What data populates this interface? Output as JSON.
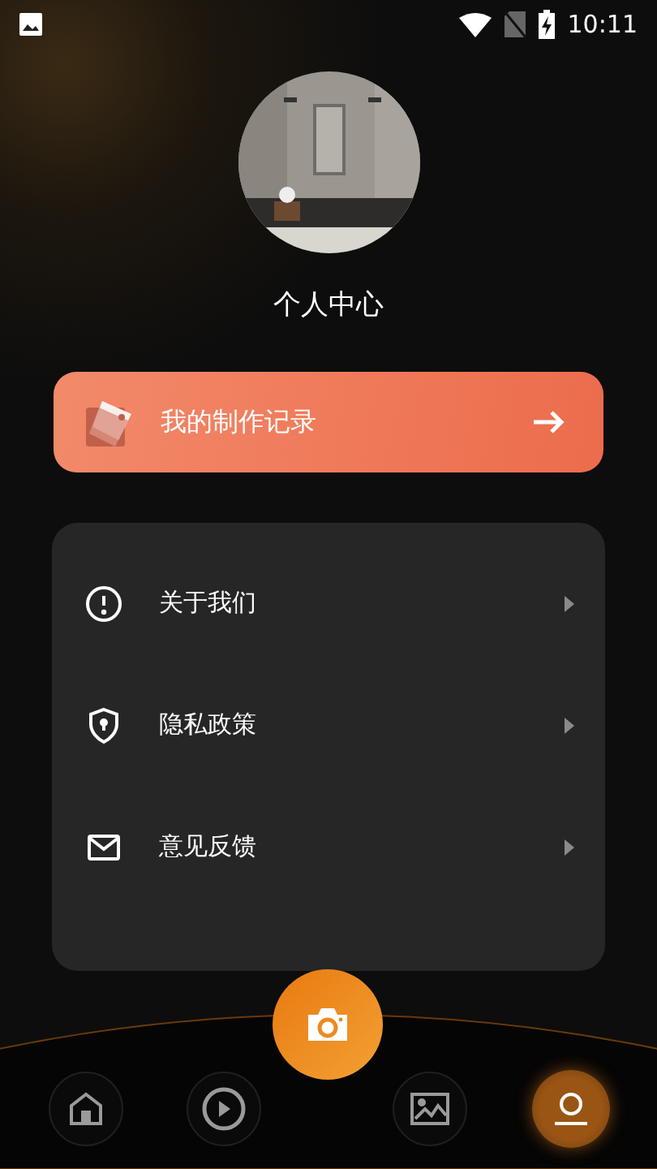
{
  "status_bar": {
    "time": "10:11"
  },
  "profile": {
    "title": "个人中心"
  },
  "records_button": {
    "label": "我的制作记录"
  },
  "menu": [
    {
      "kind": "info",
      "label": "关于我们"
    },
    {
      "kind": "shield",
      "label": "隐私政策"
    },
    {
      "kind": "mail",
      "label": "意见反馈"
    }
  ],
  "nav": [
    {
      "kind": "home",
      "selected": false
    },
    {
      "kind": "play",
      "selected": false
    },
    {
      "kind": "camera",
      "selected": false
    },
    {
      "kind": "gallery",
      "selected": false
    },
    {
      "kind": "profile",
      "selected": true
    }
  ]
}
